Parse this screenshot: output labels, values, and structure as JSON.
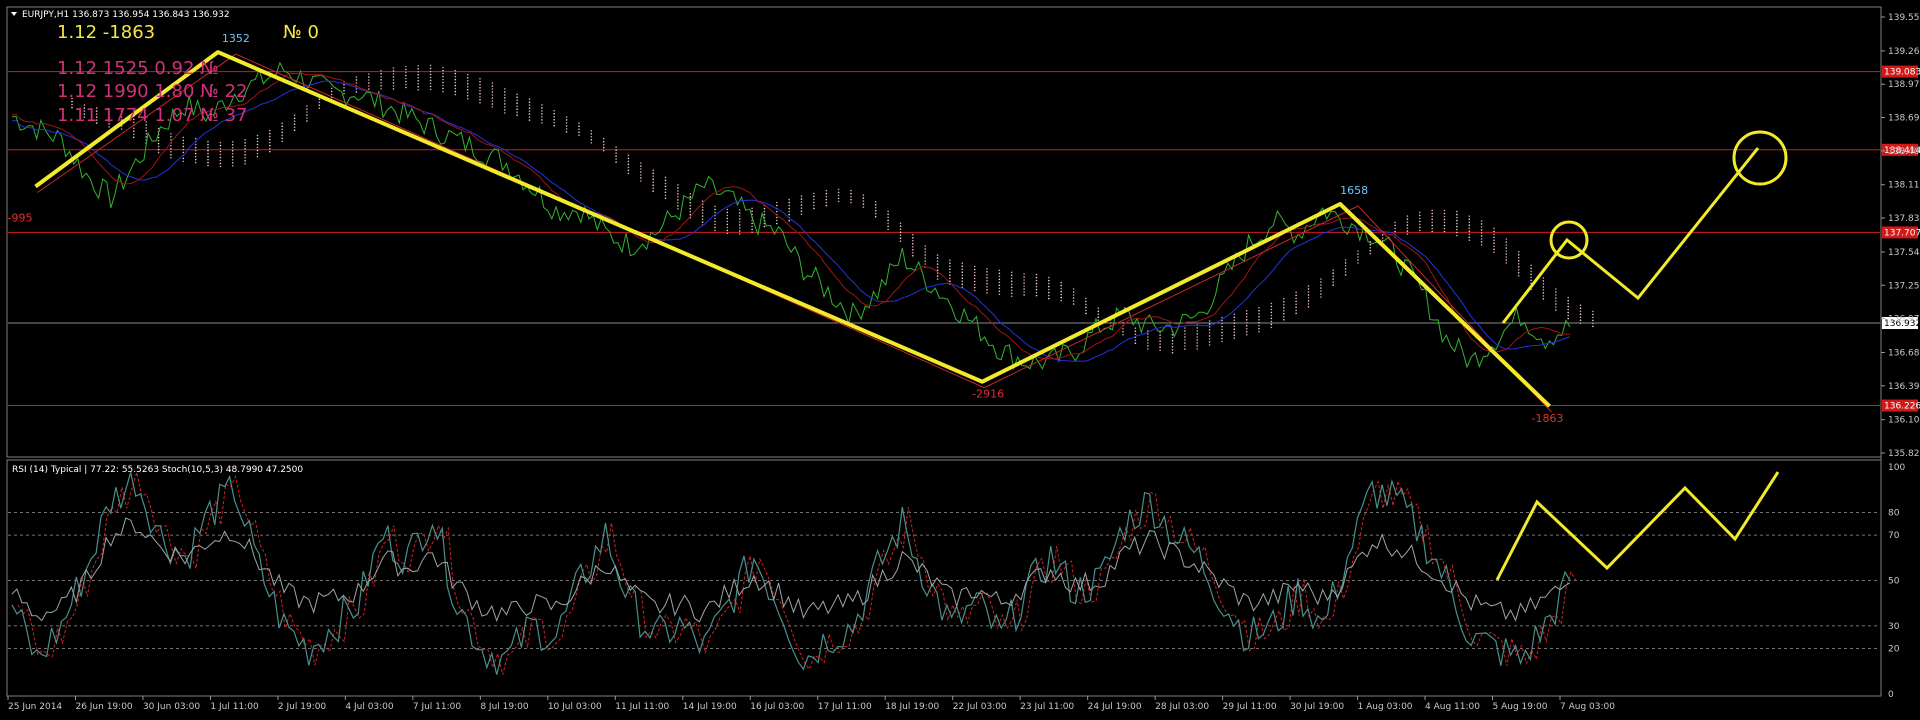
{
  "main_panel": {
    "header": "EURJPY,H1  136.873 136.954 136.843 136.932",
    "info_lines": [
      {
        "text": "1.12   -1863",
        "color": "#f5e642"
      },
      {
        "text": "1.12   1525   0.92   №",
        "color": "#d1317a"
      },
      {
        "text": "1.12   1990   1.80   № 22",
        "color": "#d1317a"
      },
      {
        "text": "1.11   1774   1.07   № 37",
        "color": "#d1317a"
      }
    ],
    "info_number": "№ 0",
    "current_price": "136.932",
    "price_ticks": [
      "139.550",
      "139.260",
      "138.975",
      "138.690",
      "138.405",
      "138.115",
      "137.830",
      "137.540",
      "137.255",
      "136.970",
      "136.680",
      "136.395",
      "136.105",
      "135.820"
    ],
    "level_labels": [
      "139.083",
      "138.414",
      "137.707",
      "136.226"
    ],
    "zigzag_labels": [
      {
        "text": "-995",
        "color": "#e03030"
      },
      {
        "text": "1352",
        "color": "#6cc6ff"
      },
      {
        "text": "-2916",
        "color": "#e03030"
      },
      {
        "text": "1658",
        "color": "#6cc6ff"
      },
      {
        "text": "-1863",
        "color": "#e03030"
      }
    ]
  },
  "indicator_panel": {
    "header": "RSI (14) Typical | 77.22: 55.5263  Stoch(10,5,3) 48.7990 47.2500",
    "levels": [
      "100",
      "80",
      "70",
      "50",
      "30",
      "20",
      "0"
    ]
  },
  "x_axis": {
    "ticks": [
      "25 Jun 2014",
      "26 Jun 19:00",
      "30 Jun 03:00",
      "1 Jul 11:00",
      "2 Jul 19:00",
      "4 Jul 03:00",
      "7 Jul 11:00",
      "8 Jul 19:00",
      "10 Jul 03:00",
      "11 Jul 11:00",
      "14 Jul 19:00",
      "16 Jul 03:00",
      "17 Jul 11:00",
      "18 Jul 19:00",
      "22 Jul 03:00",
      "23 Jul 11:00",
      "24 Jul 19:00",
      "28 Jul 03:00",
      "29 Jul 11:00",
      "30 Jul 19:00",
      "1 Aug 03:00",
      "4 Aug 11:00",
      "5 Aug 19:00",
      "7 Aug 03:00"
    ]
  },
  "colors": {
    "background": "#000000",
    "price_line": "#33b530",
    "level_line": "#d01a1a",
    "annotation": "#f2ea2a",
    "rsi_line": "#9da7a7",
    "stoch_main": "#4c8f8c",
    "stoch_signal": "#d22323",
    "axis_text": "#c8c8c8"
  },
  "chart_data": {
    "type": "line",
    "symbol": "EURJPY",
    "timeframe": "H1",
    "y_axis_range": [
      135.82,
      139.55
    ],
    "horizontal_levels": [
      139.083,
      138.414,
      137.707,
      136.932,
      136.226
    ],
    "zigzag_points": [
      {
        "x": "26 Jun",
        "y": 138.1,
        "label": "-995"
      },
      {
        "x": "2 Jul",
        "y": 139.25,
        "label": "1352"
      },
      {
        "x": "23 Jul",
        "y": 136.43,
        "label": "-2916"
      },
      {
        "x": "31 Jul",
        "y": 137.95,
        "label": "1658"
      },
      {
        "x": "6 Aug",
        "y": 136.22,
        "label": "-1863"
      }
    ],
    "price_series": [
      138.7,
      138.6,
      138.5,
      138.2,
      138.0,
      138.3,
      138.6,
      138.8,
      138.7,
      138.9,
      139.0,
      139.1,
      139.0,
      138.9,
      138.9,
      138.8,
      138.7,
      138.6,
      138.5,
      138.4,
      138.3,
      138.1,
      137.9,
      137.9,
      137.7,
      137.6,
      137.7,
      137.9,
      138.1,
      138.0,
      137.8,
      137.7,
      137.4,
      137.2,
      137.0,
      137.2,
      137.5,
      137.3,
      137.1,
      136.9,
      136.7,
      136.6,
      136.6,
      136.7,
      136.9,
      137.0,
      136.9,
      136.9,
      137.0,
      137.3,
      137.6,
      137.8,
      137.7,
      137.9,
      137.8,
      137.7,
      137.5,
      137.2,
      136.8,
      136.6,
      136.8,
      137.0,
      136.8,
      136.9
    ],
    "stoch_series": [
      40,
      15,
      30,
      55,
      85,
      95,
      70,
      60,
      80,
      90,
      55,
      30,
      20,
      30,
      40,
      70,
      60,
      80,
      40,
      20,
      15,
      30,
      25,
      50,
      70,
      40,
      25,
      30,
      20,
      40,
      60,
      40,
      15,
      25,
      30,
      55,
      75,
      50,
      30,
      40,
      25,
      45,
      60,
      45,
      50,
      75,
      85,
      70,
      60,
      40,
      25,
      30,
      45,
      30,
      60,
      90,
      85,
      70,
      50,
      25,
      20,
      15,
      30,
      50
    ],
    "rsi_series": [
      45,
      35,
      38,
      50,
      70,
      75,
      65,
      60,
      68,
      72,
      58,
      45,
      40,
      42,
      45,
      60,
      55,
      62,
      48,
      38,
      35,
      40,
      38,
      48,
      58,
      45,
      38,
      40,
      36,
      45,
      52,
      45,
      35,
      38,
      40,
      50,
      60,
      52,
      42,
      46,
      40,
      48,
      55,
      48,
      50,
      62,
      68,
      62,
      56,
      48,
      40,
      42,
      48,
      42,
      52,
      68,
      65,
      58,
      50,
      40,
      36,
      35,
      42,
      49
    ],
    "indicator_levels": [
      20,
      30,
      50,
      70,
      80
    ]
  }
}
